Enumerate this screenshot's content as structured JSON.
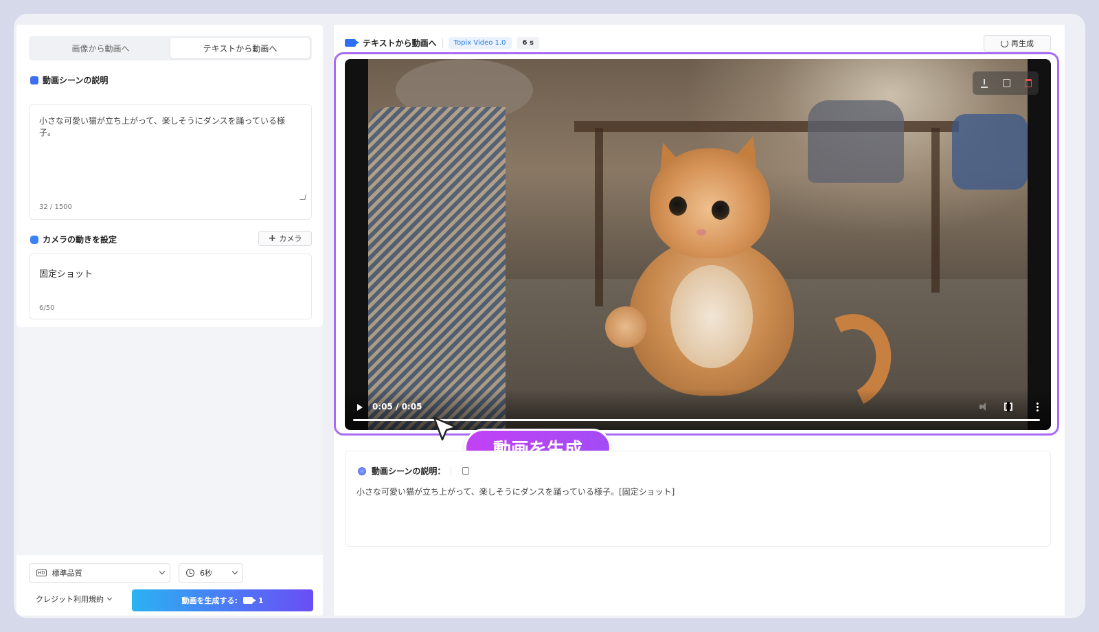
{
  "tabs": [
    {
      "label": "画像から動画へ",
      "active": false
    },
    {
      "label": "テキストから動画へ",
      "active": true
    }
  ],
  "scene_section": {
    "title": "動画シーンの説明",
    "text": "小さな可愛い猫が立ち上がって、楽しそうにダンスを踊っている様子。",
    "count": "32 / 1500",
    "icon": "edit-doc-icon"
  },
  "camera_section": {
    "title": "カメラの動きを設定",
    "add_label": "カメラ",
    "value": "固定ショット",
    "count": "6/50",
    "icon": "camera-icon"
  },
  "bottom": {
    "quality": "標準品質",
    "duration": "6秒",
    "terms": "クレジット利用規約",
    "generate_label": "動画を生成する:",
    "generate_credits": "1"
  },
  "header": {
    "title": "テキストから動画へ",
    "model": "Topix Video 1.0",
    "duration": "6 s",
    "regen_label": "再生成"
  },
  "player": {
    "time": "0:05 / 0:05",
    "progress": 1.0
  },
  "overlay_badge": "動画を生成",
  "description": {
    "title": "動画シーンの説明：",
    "text": "小さな可愛い猫が立ち上がって、楽しそうにダンスを踊っている様子。[固定ショット]"
  },
  "colors": {
    "accent_purple": "#a86af6",
    "badge_gradient_start": "#c241f5",
    "button_gradient_start": "#2ab3f1",
    "button_gradient_end": "#6a4ef5",
    "model_badge": "#2d7be0",
    "delete_red": "#ef4a4a"
  }
}
